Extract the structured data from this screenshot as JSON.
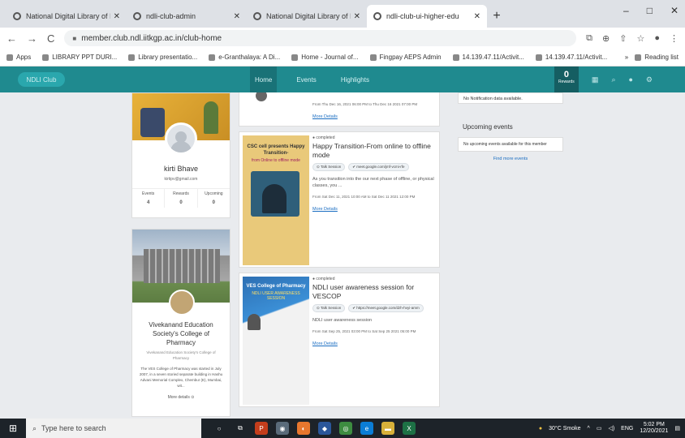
{
  "browser": {
    "tabs": [
      {
        "title": "National Digital Library of India",
        "active": false
      },
      {
        "title": "ndli-club-admin",
        "active": false
      },
      {
        "title": "National Digital Library of India",
        "active": false
      },
      {
        "title": "ndli-club-ui-higher-edu",
        "active": true
      }
    ],
    "new_tab": "+",
    "window_controls": {
      "minimize": "–",
      "maximize": "□",
      "close": "✕"
    },
    "url": "member.club.ndl.iitkgp.ac.in/club-home",
    "nav": {
      "back": "←",
      "forward": "→",
      "reload": "C"
    },
    "bookmarks": [
      "Apps",
      "LIBRARY PPT DURI...",
      "Library presentatio...",
      "e-Granthalaya: A Di...",
      "Home - Journal of...",
      "Fingpay AEPS Admin",
      "14.139.47.11/Activit...",
      "14.139.47.11/Activit..."
    ],
    "bookmarks_overflow": "»",
    "reading_list": "Reading list"
  },
  "site": {
    "logo": "NDLI Club",
    "nav": [
      "Home",
      "Events",
      "Highlights"
    ],
    "rewards_value": "0",
    "rewards_label": "Rewards"
  },
  "profile": {
    "name": "kirti Bhave",
    "email": "kirtipv@gmail.com",
    "stats": [
      {
        "label": "Events",
        "value": "4"
      },
      {
        "label": "Rewards",
        "value": "0"
      },
      {
        "label": "Upcoming",
        "value": "0"
      }
    ]
  },
  "college": {
    "name": "Vivekanand Education Society's College of Pharmacy",
    "sub": "Vivekanand Education Society's College of Pharmacy",
    "desc": "The VES College of Pharmacy was started in July 2007, in a seven storied separate building in Hashu Advani Memorial Complex, Chembur (E), Mumbai, wit...",
    "more": "More details ⊙"
  },
  "events": [
    {
      "status": "",
      "title": "",
      "chips": [],
      "desc": "",
      "time": "From Thu Dec 16, 2021 06:00 PM to Thu Dec 16 2021 07:00 PM",
      "link": "More Details",
      "poster_title": "",
      "poster_sub": ""
    },
    {
      "status": "● completed",
      "title": "Happy Transition-From online to offline mode",
      "chips": [
        "⊙ Talk Session",
        "✔ meet.google.com/jmf-vcmi-rfe"
      ],
      "desc": "As you transition into the our next phase of offline, or physical classes, you ...",
      "time": "From Sat Dec 11, 2021 10:00 AM to Sat Dec 11 2021 12:00 PM",
      "link": "More Details",
      "poster_title": "CSC cell presents Happy Transition-",
      "poster_sub": "from Online to offline mode"
    },
    {
      "status": "● completed",
      "title": "NDLI user awareness session for VESCOP",
      "chips": [
        "⊙ Talk Session",
        "✔ https://meet.google.com/dzh-hvyi-amm"
      ],
      "desc": "NDLI user awareness session",
      "time": "From Sat Sep 25, 2021 03:00 PM to Sat Sep 25 2021 05:00 PM",
      "link": "More Details",
      "poster_title": "VES College of Pharmacy",
      "poster_sub": "NDLI USER AWARENESS SESSION"
    }
  ],
  "sidebar": {
    "notif_text": "No Notification data available.",
    "upcoming_title": "Upcoming events",
    "upcoming_text": "No upcoming events available for this member",
    "find_more": "Find more events"
  },
  "taskbar": {
    "search_placeholder": "Type here to search",
    "weather": "30°C Smoke",
    "lang": "ENG",
    "time": "5:02 PM",
    "date": "12/20/2021"
  }
}
